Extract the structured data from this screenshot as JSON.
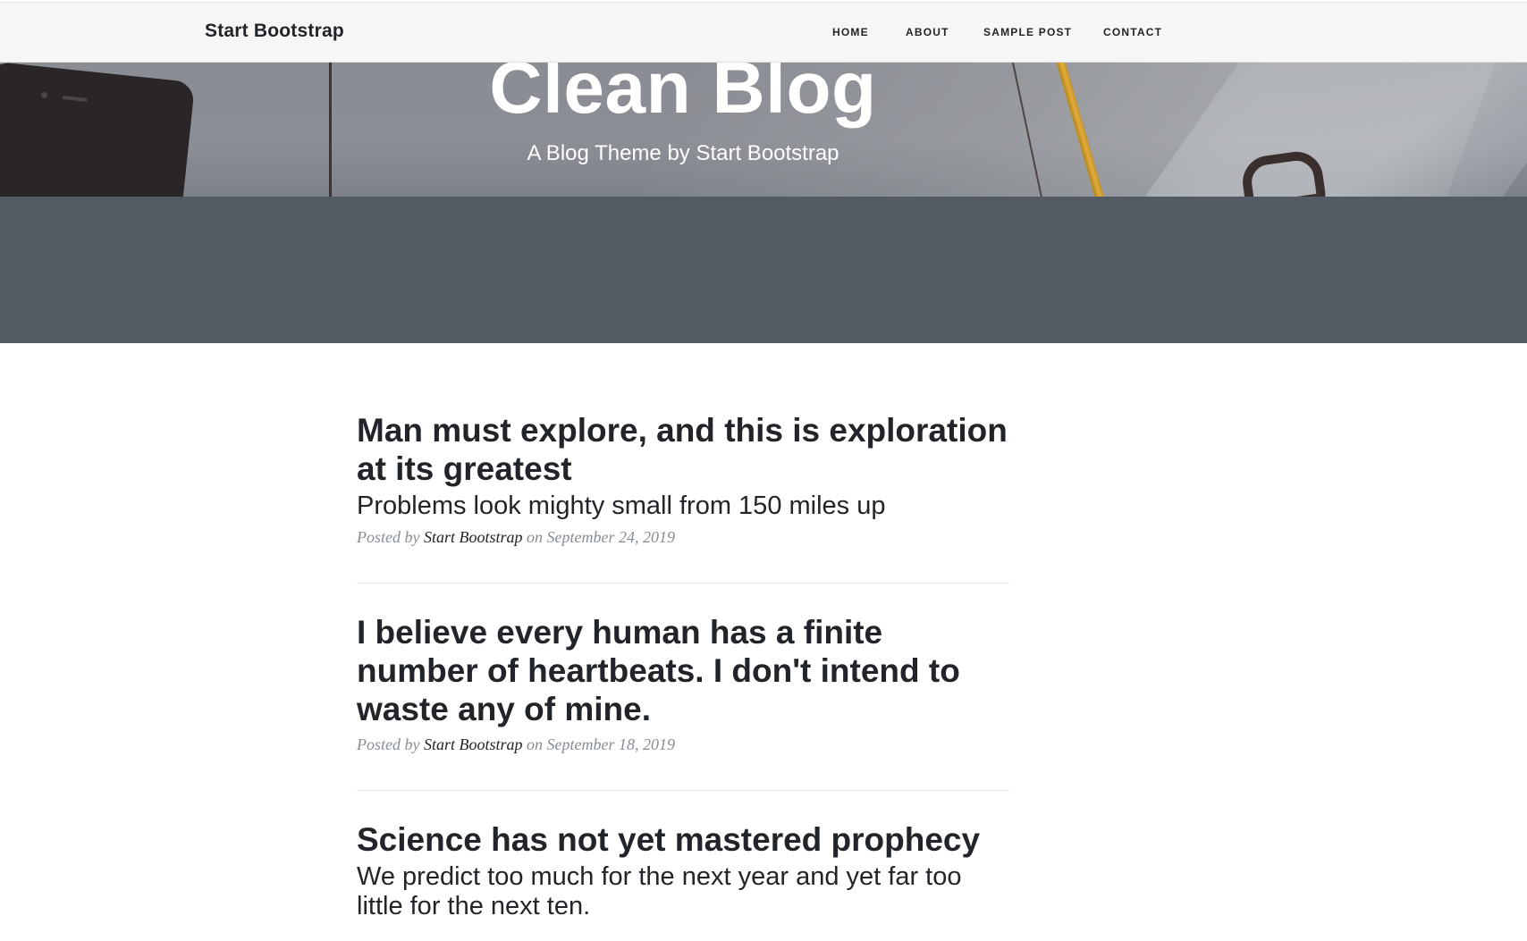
{
  "navbar": {
    "brand": "Start Bootstrap",
    "links": [
      "HOME",
      "ABOUT",
      "SAMPLE POST",
      "CONTACT"
    ]
  },
  "header": {
    "title": "Clean Blog",
    "subtitle": "A Blog Theme by Start Bootstrap"
  },
  "posts": [
    {
      "title": "Man must explore, and this is exploration at its greatest",
      "subtitle": "Problems look mighty small from 150 miles up",
      "meta_prefix": "Posted by",
      "author": "Start Bootstrap",
      "meta_on": "on September 24, 2019"
    },
    {
      "title": "I believe every human has a finite number of heartbeats. I don't intend to waste any of mine.",
      "meta_prefix": "Posted by",
      "author": "Start Bootstrap",
      "meta_on": "on September 18, 2019"
    },
    {
      "title": "Science has not yet mastered prophecy",
      "subtitle": "We predict too much for the next year and yet far too little for the next ten."
    }
  ],
  "colors": {
    "navbar_bg": "#f6f6f6",
    "header_overlay": "#525a63",
    "text": "#212529",
    "meta": "#868e96"
  }
}
